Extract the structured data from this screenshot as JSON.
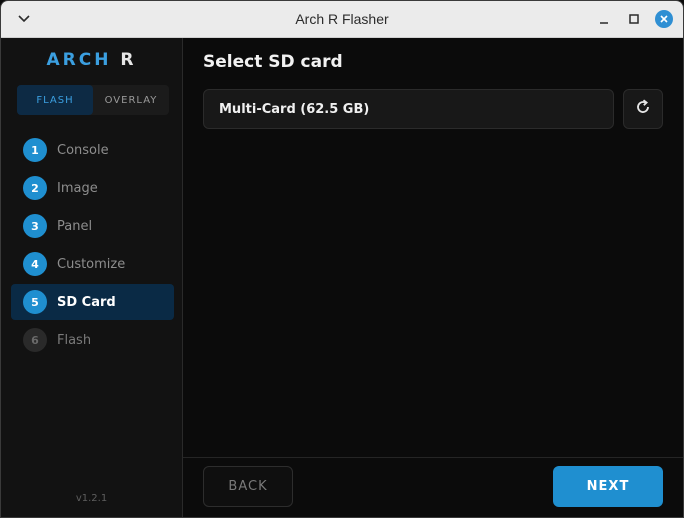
{
  "window": {
    "title": "Arch R Flasher"
  },
  "sidebar": {
    "brand_part1": "ARCH",
    "brand_part2": "R",
    "modes": [
      {
        "label": "FLASH",
        "active": true
      },
      {
        "label": "OVERLAY",
        "active": false
      }
    ],
    "steps": [
      {
        "num": "1",
        "label": "Console",
        "state": "done"
      },
      {
        "num": "2",
        "label": "Image",
        "state": "done"
      },
      {
        "num": "3",
        "label": "Panel",
        "state": "done"
      },
      {
        "num": "4",
        "label": "Customize",
        "state": "done"
      },
      {
        "num": "5",
        "label": "SD Card",
        "state": "active"
      },
      {
        "num": "6",
        "label": "Flash",
        "state": "disabled"
      }
    ],
    "version": "v1.2.1"
  },
  "main": {
    "title": "Select SD card",
    "selected_card": "Multi-Card (62.5 GB)",
    "refresh_icon": "refresh-icon",
    "back_label": "BACK",
    "next_label": "NEXT"
  },
  "colors": {
    "accent": "#1f8fd0",
    "active_step_bg": "#0a2a45"
  }
}
